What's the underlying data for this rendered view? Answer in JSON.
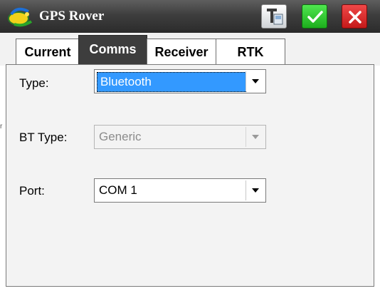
{
  "window": {
    "title": "GPS Rover",
    "icons": {
      "app": "satellite-dish-icon",
      "settings": "receiver-settings-icon",
      "ok": "checkmark-icon",
      "close": "close-icon"
    }
  },
  "tabs": [
    {
      "label": "Current"
    },
    {
      "label": "Comms",
      "selected": true
    },
    {
      "label": "Receiver"
    },
    {
      "label": "RTK"
    }
  ],
  "form": {
    "type": {
      "label": "Type:",
      "value": "Bluetooth"
    },
    "bt_type": {
      "label": "BT Type:",
      "value": "Generic",
      "disabled": true
    },
    "port": {
      "label": "Port:",
      "value": "COM 1"
    }
  },
  "stray_mark": "r",
  "colors": {
    "titlebar": "#3e3e3e",
    "selected_tab": "#3d3d3d",
    "highlight": "#3399ff",
    "ok_button": "#22b422",
    "close_button": "#d42020"
  }
}
